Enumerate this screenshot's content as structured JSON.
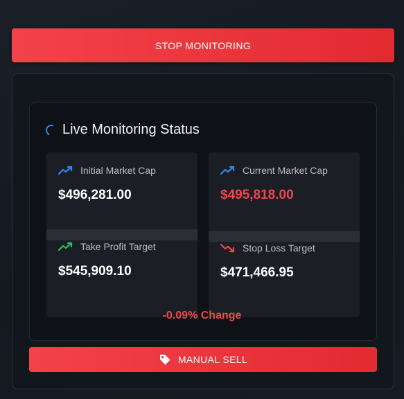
{
  "controls": {
    "stop_label": "STOP MONITORING",
    "manual_sell_label": "MANUAL SELL"
  },
  "status": {
    "title": "Live Monitoring Status",
    "spinner_icon": "loading-spinner-icon"
  },
  "metrics": {
    "initial": {
      "label": "Initial Market Cap",
      "value": "$496,281.00",
      "icon": "trend-up-icon",
      "icon_color": "#3b82f6"
    },
    "current": {
      "label": "Current Market Cap",
      "value": "$495,818.00",
      "icon": "trend-up-icon",
      "icon_color": "#3b82f6",
      "value_color": "#f0464c"
    },
    "take_profit": {
      "label": "Take Profit Target",
      "value": "$545,909.10",
      "icon": "trend-up-icon",
      "icon_color": "#22c55e"
    },
    "stop_loss": {
      "label": "Stop Loss Target",
      "value": "$471,466.95",
      "icon": "trend-down-icon",
      "icon_color": "#f0464c"
    }
  },
  "change": {
    "text": "-0.09% Change",
    "color": "#f0464c"
  },
  "colors": {
    "accent_red": "#e22a31",
    "accent_blue": "#3b82f6",
    "accent_green": "#22c55e"
  }
}
